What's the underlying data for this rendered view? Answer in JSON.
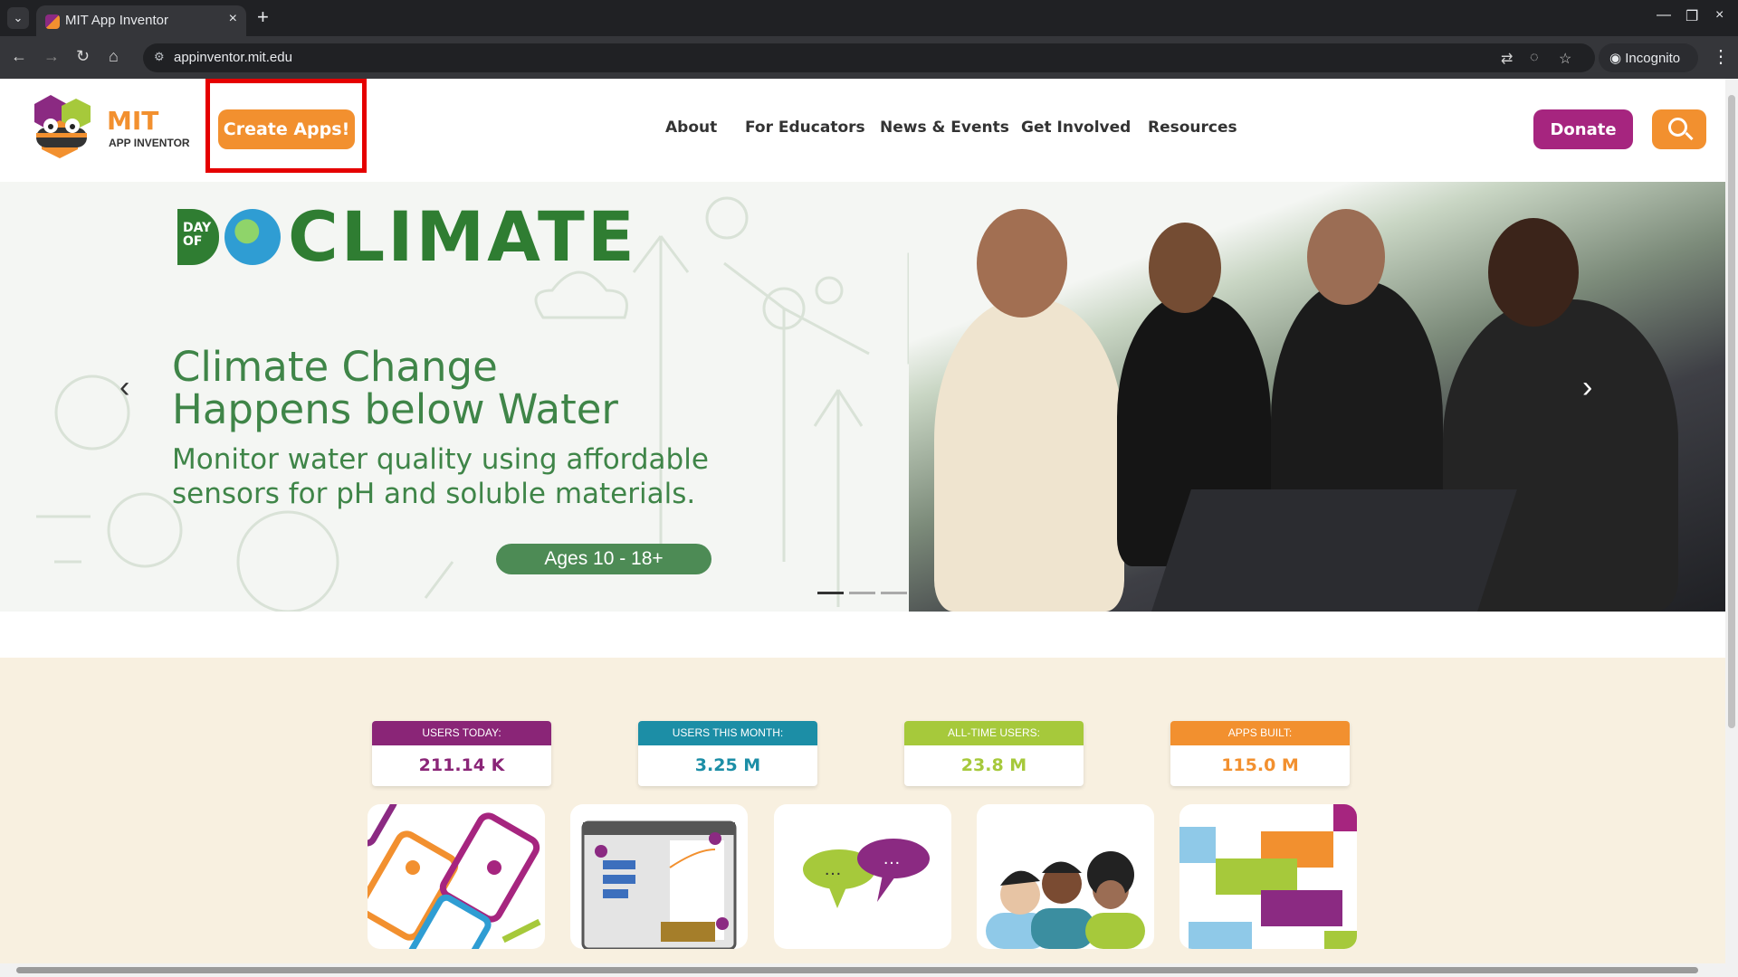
{
  "browser": {
    "tab_title": "MIT App Inventor",
    "url": "appinventor.mit.edu",
    "incognito_label": "Incognito"
  },
  "header": {
    "logo_line1": "MIT",
    "logo_line2": "APP INVENTOR",
    "create_button": "Create Apps!",
    "nav": [
      "About",
      "For Educators",
      "News & Events",
      "Get Involved",
      "Resources"
    ],
    "donate_button": "Donate"
  },
  "hero": {
    "badge_day": "DAY OF",
    "badge_climate": "CLIMATE",
    "title": "Climate Change Happens below Water",
    "subtitle": "Monitor water quality using affordable sensors for pH and soluble materials.",
    "ages": "Ages 10 - 18+",
    "slides": 3,
    "active_slide": 1
  },
  "stats": [
    {
      "label": "USERS TODAY:",
      "value": "211.14 K",
      "color": "#8a2577"
    },
    {
      "label": "USERS THIS MONTH:",
      "value": "3.25 M",
      "color": "#1c8ea6"
    },
    {
      "label": "ALL-TIME USERS:",
      "value": "23.8 M",
      "color": "#a6c93b"
    },
    {
      "label": "APPS BUILT:",
      "value": "115.0 M",
      "color": "#f2902f"
    }
  ],
  "colors": {
    "brand_orange": "#f2902f",
    "brand_purple": "#a6257f",
    "hero_green": "#3f8548",
    "stats_bg": "#f8f0e0"
  },
  "icons": [
    "tab-list-icon",
    "favicon-icon",
    "close-icon",
    "plus-icon",
    "back-arrow-icon",
    "forward-arrow-icon",
    "reload-icon",
    "home-icon",
    "site-info-icon",
    "translate-icon",
    "eye-off-icon",
    "star-icon",
    "incognito-icon",
    "menu-dots-icon",
    "search-icon",
    "chevron-left-icon",
    "chevron-right-icon"
  ]
}
